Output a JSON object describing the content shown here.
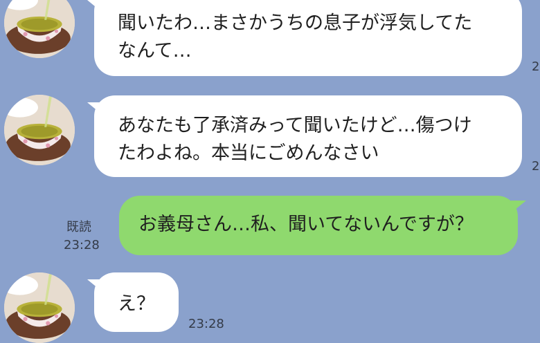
{
  "messages": [
    {
      "sender": "other",
      "lines": [
        "聞いたわ…まさかうちの息子が浮気してた",
        "なんて…"
      ],
      "time_partial": "2"
    },
    {
      "sender": "other",
      "lines": [
        "あなたも了承済みって聞いたけど…傷つけ",
        "たわよね。本当にごめんなさい"
      ],
      "time_partial": "2"
    },
    {
      "sender": "me",
      "text": "お義母さん…私、聞いてないんですが？",
      "read_label": "既読",
      "time": "23:28"
    },
    {
      "sender": "other",
      "text": "え？",
      "time": "23:28"
    }
  ],
  "colors": {
    "background": "#8aa1cc",
    "incoming_bubble": "#ffffff",
    "outgoing_bubble": "#8fd96e",
    "meta_text": "#343b48"
  },
  "icons": {
    "avatar": "green-tea-cup-avatar"
  }
}
